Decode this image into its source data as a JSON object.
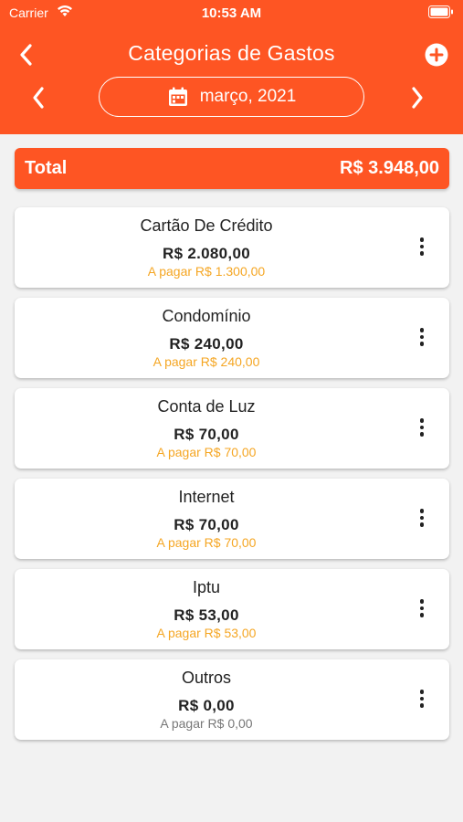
{
  "status_bar": {
    "carrier": "Carrier",
    "time": "10:53 AM"
  },
  "header": {
    "title": "Categorias de Gastos",
    "month": "março, 2021"
  },
  "total": {
    "label": "Total",
    "value": "R$ 3.948,00"
  },
  "categories": [
    {
      "name": "Cartão De Crédito",
      "amount": "R$ 2.080,00",
      "pending": "A pagar R$ 1.300,00"
    },
    {
      "name": "Condomínio",
      "amount": "R$ 240,00",
      "pending": "A pagar R$ 240,00"
    },
    {
      "name": "Conta de Luz",
      "amount": "R$ 70,00",
      "pending": "A pagar R$ 70,00"
    },
    {
      "name": "Internet",
      "amount": "R$ 70,00",
      "pending": "A pagar R$ 70,00"
    },
    {
      "name": "Iptu",
      "amount": "R$ 53,00",
      "pending": "A pagar R$ 53,00"
    },
    {
      "name": "Outros",
      "amount": "R$ 0,00",
      "pending": "A pagar R$ 0,00"
    }
  ],
  "colors": {
    "accent": "#fe5523",
    "pending": "#f5a623",
    "pending_zero": "#777777",
    "background": "#f2f2f2"
  }
}
